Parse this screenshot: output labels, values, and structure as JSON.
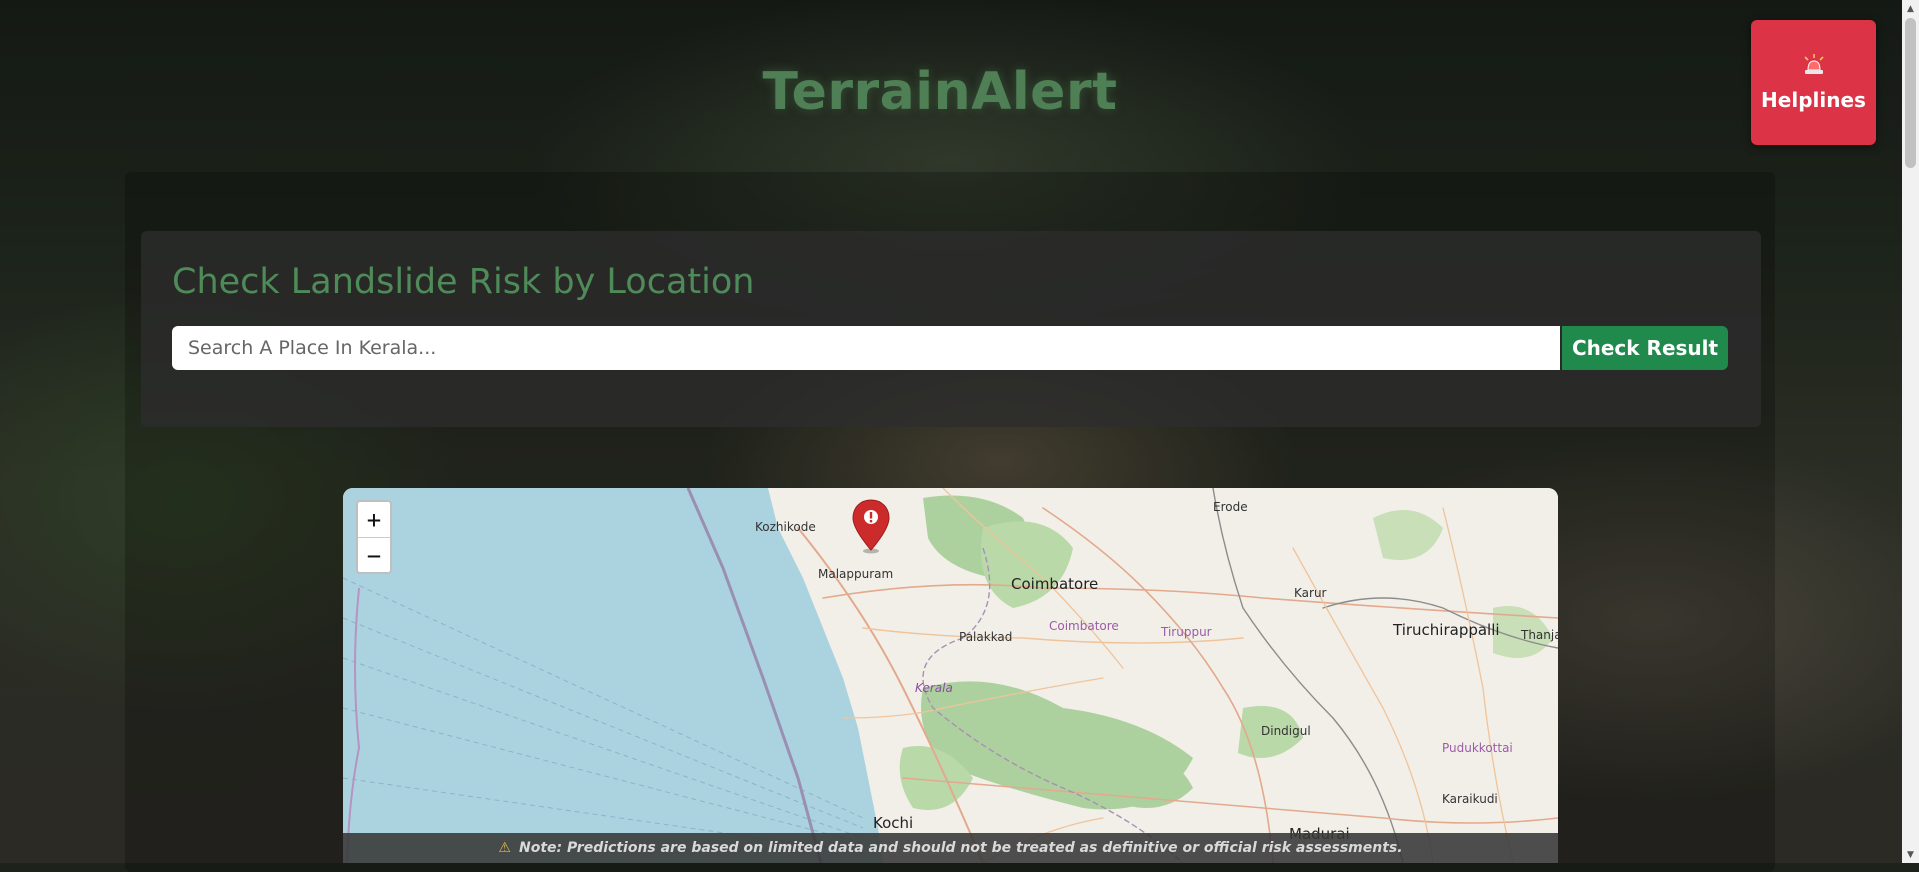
{
  "app": {
    "title": "TerrainAlert"
  },
  "helplines": {
    "label": "Helplines",
    "icon": "siren-icon"
  },
  "search": {
    "heading": "Check Landslide Risk by Location",
    "placeholder": "Search A Place In Kerala...",
    "value": "",
    "button_label": "Check Result"
  },
  "map": {
    "zoom_in": "+",
    "zoom_out": "−",
    "labels": {
      "kozhikode": "Kozhikode",
      "malappuram": "Malappuram",
      "erode": "Erode",
      "coimbatore": "Coimbatore",
      "coimbatore_region": "Coimbatore",
      "tiruppur": "Tiruppur",
      "karur": "Karur",
      "palakkad": "Palakkad",
      "tiruchirappalli": "Tiruchirappalli",
      "thanja": "Thanja",
      "kerala": "Kerala",
      "dindigul": "Dindigul",
      "pudukkottai": "Pudukkottai",
      "karaikudi": "Karaikudi",
      "kochi": "Kochi",
      "madurai": "Madurai"
    },
    "marker_icon": "location-alert-marker-icon"
  },
  "note": {
    "icon": "warning-icon",
    "text": "Note: Predictions are based on limited data and should not be treated as definitive or official risk assessments."
  },
  "colors": {
    "accent_green": "#4f8a59",
    "button_green": "#1f8a4c",
    "helplines_red": "#dc3346",
    "sea": "#aad3df",
    "forest": "#add19e"
  }
}
